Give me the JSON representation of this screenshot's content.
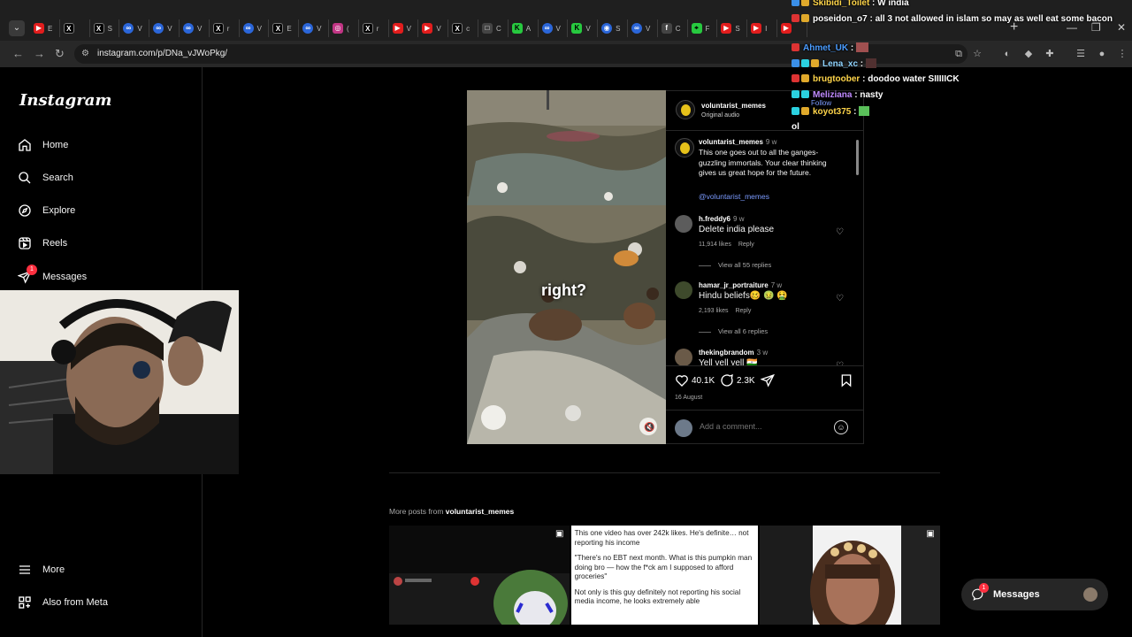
{
  "browser": {
    "url": "instagram.com/p/DNa_vJWoPkg/",
    "tabs": [
      {
        "icon": "youtube-icon",
        "title": "E",
        "cls": "f-yt",
        "glyph": "▶"
      },
      {
        "icon": "x-icon",
        "title": "",
        "cls": "f-x",
        "glyph": "X"
      },
      {
        "icon": "x-icon",
        "title": "S",
        "cls": "f-x",
        "glyph": "X"
      },
      {
        "icon": "copilot-icon",
        "title": "V",
        "cls": "f-cp",
        "glyph": "∞"
      },
      {
        "icon": "copilot-icon",
        "title": "V",
        "cls": "f-cp",
        "glyph": "∞"
      },
      {
        "icon": "copilot-icon",
        "title": "V",
        "cls": "f-cp",
        "glyph": "∞"
      },
      {
        "icon": "x-icon",
        "title": "r",
        "cls": "f-x",
        "glyph": "X"
      },
      {
        "icon": "copilot-icon",
        "title": "V",
        "cls": "f-cp",
        "glyph": "∞"
      },
      {
        "icon": "x-icon",
        "title": "E",
        "cls": "f-x",
        "glyph": "X"
      },
      {
        "icon": "copilot-icon",
        "title": "V",
        "cls": "f-cp",
        "glyph": "∞"
      },
      {
        "icon": "instagram-icon",
        "title": "(",
        "cls": "f-ig",
        "glyph": "◎"
      },
      {
        "icon": "x-icon",
        "title": "r",
        "cls": "f-x",
        "glyph": "X"
      },
      {
        "icon": "youtube-icon",
        "title": "V",
        "cls": "f-yt",
        "glyph": "▶"
      },
      {
        "icon": "youtube-icon",
        "title": "V",
        "cls": "f-yt",
        "glyph": "▶"
      },
      {
        "icon": "x-icon",
        "title": "c",
        "cls": "f-x",
        "glyph": "X"
      },
      {
        "icon": "chat-icon",
        "title": "C",
        "cls": "f-g",
        "glyph": "□"
      },
      {
        "icon": "kick-icon",
        "title": "A",
        "cls": "f-k",
        "glyph": "K"
      },
      {
        "icon": "copilot-icon",
        "title": "V",
        "cls": "f-cp",
        "glyph": "∞"
      },
      {
        "icon": "kick-icon",
        "title": "V",
        "cls": "f-k",
        "glyph": "K"
      },
      {
        "icon": "discord-icon",
        "title": "S",
        "cls": "f-cp",
        "glyph": "◉"
      },
      {
        "icon": "copilot-icon",
        "title": "V",
        "cls": "f-cp",
        "glyph": "∞"
      },
      {
        "icon": "font-icon",
        "title": "C",
        "cls": "f-g",
        "glyph": "f"
      },
      {
        "icon": "pin-icon",
        "title": "F",
        "cls": "f-k",
        "glyph": "⌖"
      },
      {
        "icon": "youtube-icon",
        "title": "S",
        "cls": "f-yt",
        "glyph": "▶"
      },
      {
        "icon": "youtube-icon",
        "title": "I",
        "cls": "f-yt",
        "glyph": "▶"
      },
      {
        "icon": "youtube-icon",
        "title": "",
        "cls": "f-yt",
        "glyph": "▶"
      }
    ]
  },
  "sidebar": {
    "logo": "Instagram",
    "items": [
      {
        "label": "Home",
        "icon": "home-icon"
      },
      {
        "label": "Search",
        "icon": "search-icon"
      },
      {
        "label": "Explore",
        "icon": "explore-icon"
      },
      {
        "label": "Reels",
        "icon": "reels-icon"
      },
      {
        "label": "Messages",
        "icon": "send-icon",
        "badge": "1"
      }
    ],
    "bottom": [
      {
        "label": "More",
        "icon": "menu-icon"
      },
      {
        "label": "Also from Meta",
        "icon": "meta-icon"
      }
    ]
  },
  "post": {
    "overlay_text": "right?",
    "author": "voluntarist_memes",
    "audio": "Original audio",
    "caption": {
      "user": "voluntarist_memes",
      "time": "9 w",
      "text": "This one goes out to all the ganges-guzzling immortals. Your clear thinking gives us great hope for the future.",
      "mention": "@voluntarist_memes"
    },
    "comments": [
      {
        "user": "h.freddy6",
        "time": "9 w",
        "text": "Delete india please",
        "likes": "11,914 likes",
        "reply": "Reply",
        "view_replies": "View all 55 replies"
      },
      {
        "user": "hamar_jr_portraiture",
        "time": "7 w",
        "text": "Hindu beliefs🥴 🤢 🤮",
        "likes": "2,193 likes",
        "reply": "Reply",
        "view_replies": "View all 6 replies"
      },
      {
        "user": "thekingbrandom",
        "time": "3 w",
        "text": "Yell yell yell 🇮🇳"
      }
    ],
    "like_count": "40.1K",
    "comment_count": "2.3K",
    "date": "16 August",
    "add_comment_placeholder": "Add a comment..."
  },
  "more_posts": {
    "prefix": "More posts from",
    "user": "voluntarist_memes",
    "thumb2_paragraphs": [
      "This one video has over 242k likes. He's definite… not reporting his income",
      "\"There's no EBT next month. What is this pumpkin man doing bro — how the f*ck am I supposed to afford groceries\"",
      "Not only is this guy definitely not reporting his social media income, he looks extremely able"
    ]
  },
  "chat": {
    "lines": [
      {
        "user": "Skibidi_Toilet",
        "color": "#ffd54a",
        "msg": "W india",
        "badges": [
          "b-blue",
          "b-gold"
        ]
      },
      {
        "user": "poseidon_o7",
        "color": "#ffffff",
        "msg": "all 3 not allowed in islam so may as well eat some bacon",
        "badges": [
          "b-red",
          "b-gold"
        ]
      },
      {
        "user": "Ahmet_UK",
        "color": "#4a9cff",
        "msg": "",
        "badges": [
          "b-red"
        ]
      },
      {
        "user": "Lena_xc",
        "color": "#8fd4ff",
        "msg": "",
        "badges": [
          "b-blue",
          "b-cyan",
          "b-gold"
        ]
      },
      {
        "user": "brugtoober",
        "color": "#ffd54a",
        "msg": "doodoo water SIIIIICK",
        "badges": [
          "b-red",
          "b-gold"
        ]
      },
      {
        "user": "Meliziana",
        "color": "#c08aff",
        "msg": "nasty",
        "badges": [
          "b-cyan",
          "b-cyan"
        ]
      },
      {
        "user": "koyot375",
        "color": "#ffd54a",
        "msg": "",
        "badges": [
          "b-cyan",
          "b-gold"
        ]
      }
    ],
    "follow": "Follow",
    "stray": "ol"
  },
  "dock": {
    "label": "Messages",
    "badge": "1"
  }
}
